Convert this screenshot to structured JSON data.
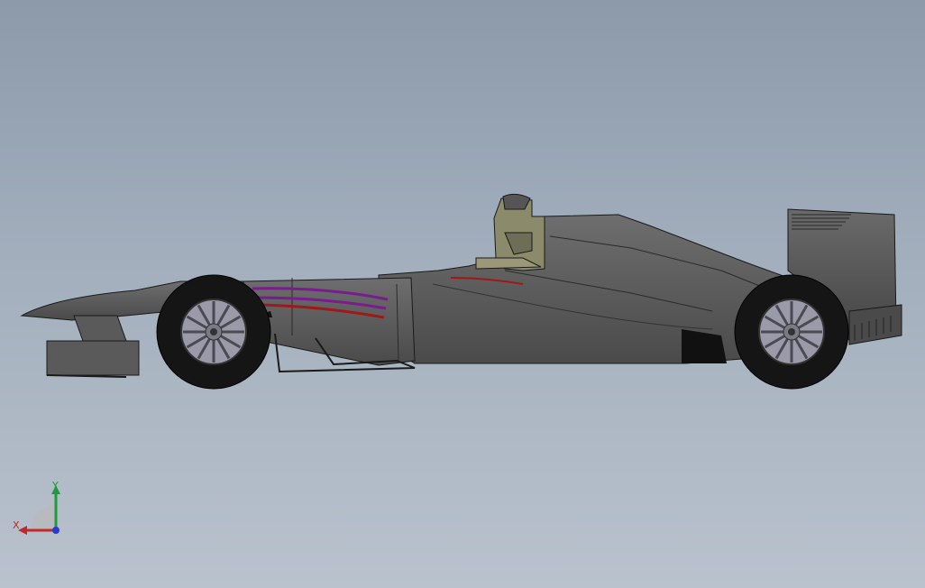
{
  "viewport": {
    "background_top": "#8c9aaa",
    "background_bottom": "#b9c2cd"
  },
  "model": {
    "body_color": "#5c5c5c",
    "body_dark": "#3d3d3d",
    "edge_color": "#1a1a1a",
    "tire_color": "#151515",
    "rim_color": "#9a9aa8",
    "stripe_purple": "#7a1b8f",
    "stripe_red": "#a01818",
    "airbox_color": "#8b8a6a"
  },
  "triad": {
    "x_label": "X",
    "y_label": "Y",
    "x_color": "#c0282a",
    "y_color": "#1f9b3a",
    "z_color": "#2a3ad0"
  }
}
